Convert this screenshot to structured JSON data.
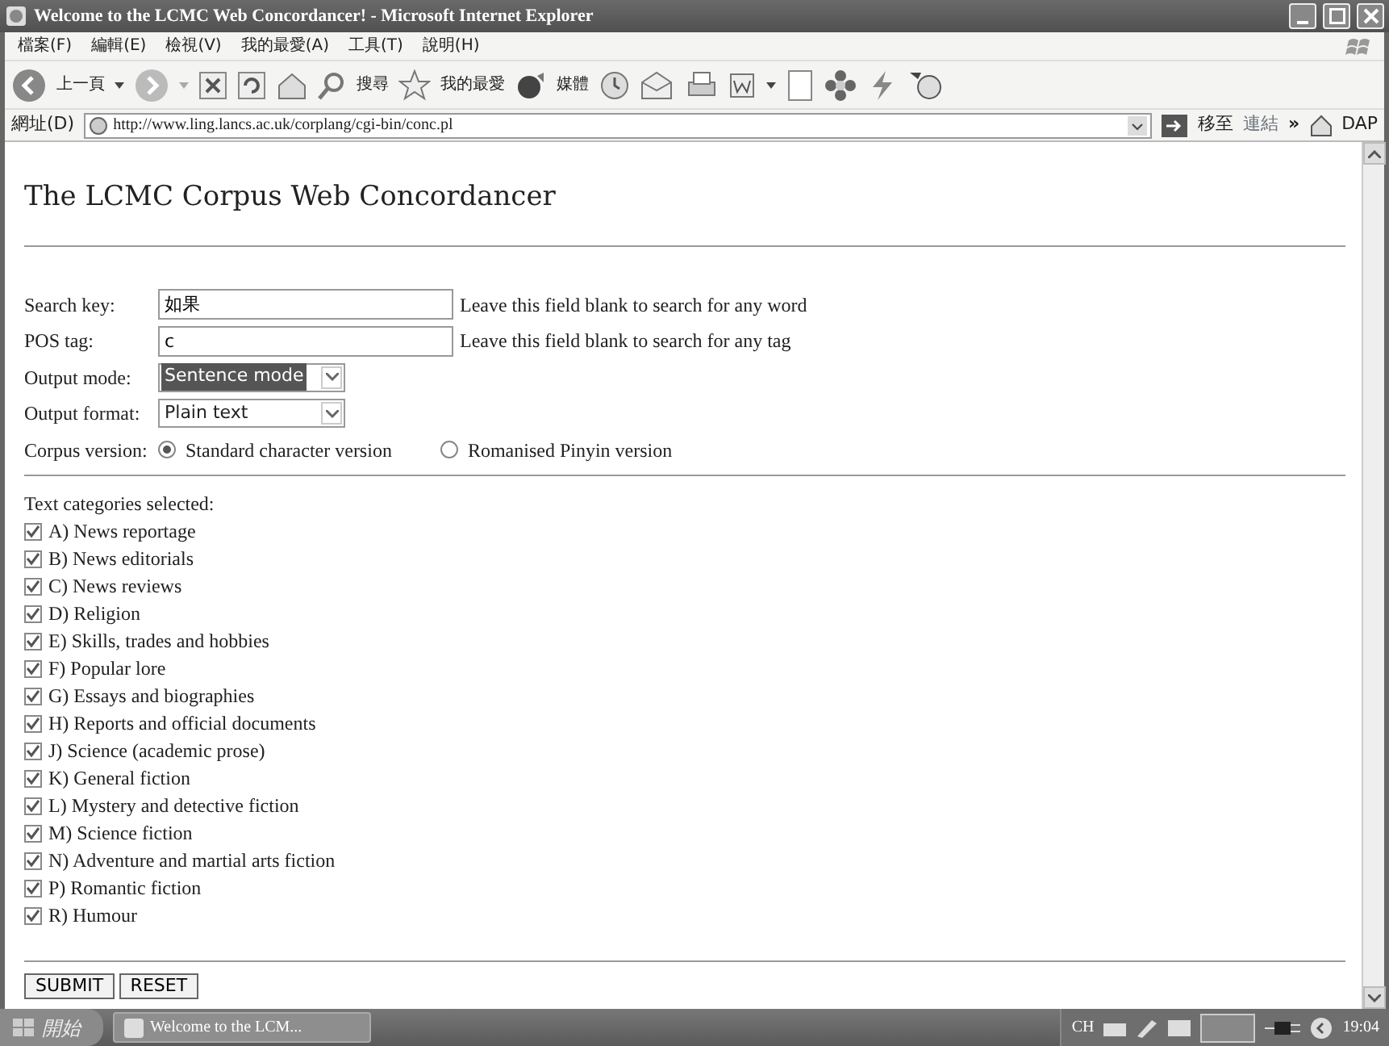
{
  "window": {
    "title": "Welcome to the LCMC Web Concordancer! - Microsoft Internet Explorer"
  },
  "menu": [
    "檔案(F)",
    "編輯(E)",
    "檢視(V)",
    "我的最愛(A)",
    "工具(T)",
    "說明(H)"
  ],
  "toolbar": {
    "back": "上一頁",
    "search": "搜尋",
    "favorites": "我的最愛",
    "media": "媒體"
  },
  "address": {
    "label": "網址(D)",
    "url": "http://www.ling.lancs.ac.uk/corplang/cgi-bin/conc.pl",
    "go": "移至",
    "links": "連結",
    "more": "»",
    "dap": "DAP"
  },
  "page": {
    "heading": "The LCMC Corpus Web Concordancer",
    "fields": [
      {
        "label": "Search key:",
        "value": "如果",
        "hint": "Leave this field blank to search for any word"
      },
      {
        "label": "POS tag:",
        "value": "c",
        "hint": "Leave this field blank to search for any tag"
      }
    ],
    "selects": [
      {
        "label": "Output mode:",
        "value": "Sentence mode",
        "focused": true
      },
      {
        "label": "Output format:",
        "value": "Plain text",
        "focused": false
      }
    ],
    "corpus_version": {
      "label": "Corpus version:",
      "options": [
        {
          "label": "Standard character version",
          "selected": true
        },
        {
          "label": "Romanised Pinyin version",
          "selected": false
        }
      ]
    },
    "categories": {
      "label": "Text categories selected:",
      "items": [
        {
          "label": "A) News reportage",
          "checked": true
        },
        {
          "label": "B) News editorials",
          "checked": true
        },
        {
          "label": "C) News reviews",
          "checked": true
        },
        {
          "label": "D) Religion",
          "checked": true
        },
        {
          "label": "E) Skills, trades and hobbies",
          "checked": true
        },
        {
          "label": "F) Popular lore",
          "checked": true
        },
        {
          "label": "G) Essays and biographies",
          "checked": true
        },
        {
          "label": "H) Reports and official documents",
          "checked": true
        },
        {
          "label": "J) Science (academic prose)",
          "checked": true
        },
        {
          "label": "K) General fiction",
          "checked": true
        },
        {
          "label": "L) Mystery and detective fiction",
          "checked": true
        },
        {
          "label": "M) Science fiction",
          "checked": true
        },
        {
          "label": "N) Adventure and martial arts fiction",
          "checked": true
        },
        {
          "label": "P) Romantic fiction",
          "checked": true
        },
        {
          "label": "R) Humour",
          "checked": true
        }
      ]
    },
    "buttons": [
      "SUBMIT",
      "RESET"
    ]
  },
  "taskbar": {
    "start": "開始",
    "task": "Welcome to the LCM...",
    "language": "CH",
    "clock": "19:04"
  }
}
